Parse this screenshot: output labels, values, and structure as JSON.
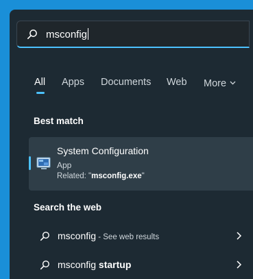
{
  "search": {
    "value": "msconfig"
  },
  "tabs": [
    {
      "label": "All",
      "active": true
    },
    {
      "label": "Apps"
    },
    {
      "label": "Documents"
    },
    {
      "label": "Web"
    },
    {
      "label": "More"
    }
  ],
  "best_match": {
    "heading": "Best match",
    "name": "System Configuration",
    "type": "App",
    "related_prefix": "Related: \"",
    "related_file": "msconfig.exe",
    "related_suffix": "\""
  },
  "web": {
    "heading": "Search the web",
    "results": [
      {
        "query": "msconfig",
        "suffix": " - See web results"
      },
      {
        "query_prefix": "msconfig ",
        "query_bold": "startup"
      }
    ]
  },
  "colors": {
    "accent": "#4cc2ff",
    "panel": "#1d2a33",
    "desktop": "#1a8fd8"
  },
  "icons": [
    "search-icon",
    "system-configuration-app-icon",
    "chevron-right-icon",
    "chevron-down-icon"
  ]
}
